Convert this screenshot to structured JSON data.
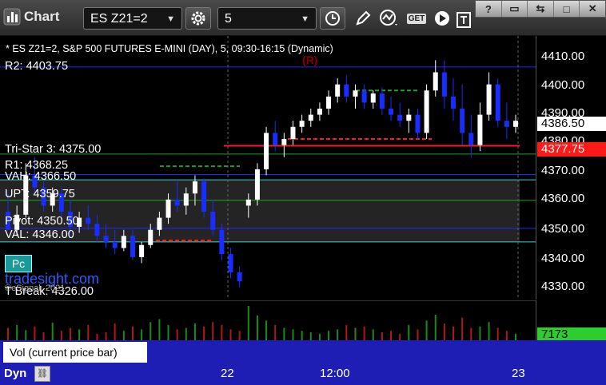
{
  "toolbar": {
    "app_title": "Chart",
    "symbol": "ES Z21=2",
    "interval": "5",
    "get_label": "GET"
  },
  "chart": {
    "header": "* ES Z21=2, S&P 500 FUTURES E-MINI (DAY), 5, 09:30-16:15 (Dynamic)",
    "marker": "(R)",
    "levels": {
      "r2": "R2: 4403.75",
      "tristar": "Tri-Star 3: 4375.00",
      "r1": "R1: 4368.25",
      "vah": "VAH: 4366.50",
      "upt": "UPT: 4359.75",
      "pivot": "Pivot: 4350.50",
      "val": "VAL: 4346.00",
      "tbreak": "T Break: 4326.00"
    },
    "pc_button": "Pc",
    "watermark": "tradesight.com",
    "copyright": "©eSignal, 2021"
  },
  "price_axis": {
    "ticks": [
      "4410.00",
      "4400.00",
      "4390.00",
      "4380.00",
      "4370.00",
      "4360.00",
      "4350.00",
      "4340.00",
      "4330.00"
    ],
    "last_price": "4386.50",
    "red_level": "4377.75"
  },
  "volume": {
    "legend": "Vol (current price bar)",
    "close": "×",
    "last": "7173"
  },
  "time_axis": {
    "dyn": "Dyn",
    "labels": [
      "22",
      "12:00",
      "23"
    ]
  },
  "colors": {
    "up_candle": "#ffffff",
    "down_candle": "#1a2dff",
    "red_line": "#ff1a1a",
    "green_dash": "#1fa31f",
    "blue_line": "#2424ff",
    "cyan_line": "#3ad0d0",
    "fib_text": "#22aa22",
    "value_area": "#2a2a2a",
    "volume_green": "#1a8a1a",
    "volume_red": "#aa1a1a"
  },
  "chart_data": {
    "type": "candlestick",
    "ylim": [
      4327,
      4414
    ],
    "candles": [
      [
        4356,
        4362,
        4352,
        4350
      ],
      [
        4350,
        4358,
        4348,
        4355
      ],
      [
        4355,
        4372,
        4354,
        4368
      ],
      [
        4368,
        4374,
        4362,
        4364
      ],
      [
        4364,
        4366,
        4356,
        4358
      ],
      [
        4358,
        4364,
        4356,
        4362
      ],
      [
        4362,
        4364,
        4354,
        4356
      ],
      [
        4356,
        4360,
        4348,
        4351
      ],
      [
        4351,
        4356,
        4349,
        4354
      ],
      [
        4354,
        4358,
        4350,
        4352
      ],
      [
        4352,
        4355,
        4346,
        4348
      ],
      [
        4348,
        4352,
        4344,
        4346
      ],
      [
        4346,
        4350,
        4342,
        4344
      ],
      [
        4344,
        4350,
        4343,
        4348
      ],
      [
        4348,
        4350,
        4340,
        4341
      ],
      [
        4341,
        4346,
        4339,
        4345
      ],
      [
        4345,
        4352,
        4344,
        4350
      ],
      [
        4350,
        4356,
        4348,
        4354
      ],
      [
        4354,
        4362,
        4352,
        4360
      ],
      [
        4360,
        4366,
        4356,
        4358
      ],
      [
        4358,
        4364,
        4355,
        4362
      ],
      [
        4362,
        4368,
        4358,
        4366
      ],
      [
        4366,
        4367,
        4354,
        4356
      ],
      [
        4356,
        4360,
        4348,
        4350
      ],
      [
        4350,
        4352,
        4340,
        4342
      ],
      [
        4342,
        4344,
        4334,
        4336
      ],
      [
        4336,
        4338,
        4331,
        4333
      ],
      [
        4358,
        4362,
        4354,
        4360
      ],
      [
        4360,
        4372,
        4358,
        4370
      ],
      [
        4370,
        4384,
        4368,
        4382
      ],
      [
        4382,
        4386,
        4376,
        4378
      ],
      [
        4378,
        4382,
        4374,
        4380
      ],
      [
        4380,
        4386,
        4378,
        4384
      ],
      [
        4384,
        4388,
        4382,
        4386
      ],
      [
        4386,
        4390,
        4384,
        4388
      ],
      [
        4388,
        4392,
        4386,
        4390
      ],
      [
        4390,
        4396,
        4388,
        4394
      ],
      [
        4394,
        4400,
        4392,
        4398
      ],
      [
        4398,
        4401,
        4392,
        4394
      ],
      [
        4394,
        4398,
        4390,
        4396
      ],
      [
        4396,
        4398,
        4390,
        4392
      ],
      [
        4392,
        4396,
        4390,
        4395
      ],
      [
        4395,
        4397,
        4388,
        4390
      ],
      [
        4390,
        4394,
        4386,
        4388
      ],
      [
        4388,
        4392,
        4384,
        4386
      ],
      [
        4386,
        4390,
        4382,
        4388
      ],
      [
        4388,
        4390,
        4380,
        4382
      ],
      [
        4382,
        4398,
        4380,
        4396
      ],
      [
        4396,
        4406,
        4394,
        4402
      ],
      [
        4402,
        4406,
        4390,
        4394
      ],
      [
        4394,
        4400,
        4386,
        4390
      ],
      [
        4390,
        4398,
        4378,
        4382
      ],
      [
        4382,
        4388,
        4374,
        4378
      ],
      [
        4378,
        4392,
        4376,
        4388
      ],
      [
        4388,
        4402,
        4386,
        4398
      ],
      [
        4398,
        4400,
        4384,
        4386
      ],
      [
        4386,
        4392,
        4380,
        4384
      ],
      [
        4384,
        4388,
        4382,
        4386
      ]
    ],
    "levels": [
      4403.75,
      4377.75,
      4375.0,
      4368.25,
      4366.5,
      4359.75,
      4350.5,
      4346.0
    ],
    "volume": [
      18,
      22,
      15,
      20,
      12,
      25,
      14,
      18,
      16,
      22,
      10,
      12,
      24,
      14,
      20,
      16,
      26,
      30,
      22,
      16,
      18,
      24,
      20,
      26,
      22,
      16,
      14,
      48,
      35,
      28,
      22,
      18,
      16,
      14,
      12,
      10,
      14,
      16,
      22,
      18,
      20,
      16,
      12,
      14,
      10,
      22,
      16,
      28,
      36,
      24,
      20,
      32,
      18,
      20,
      26,
      18,
      14,
      10
    ]
  }
}
